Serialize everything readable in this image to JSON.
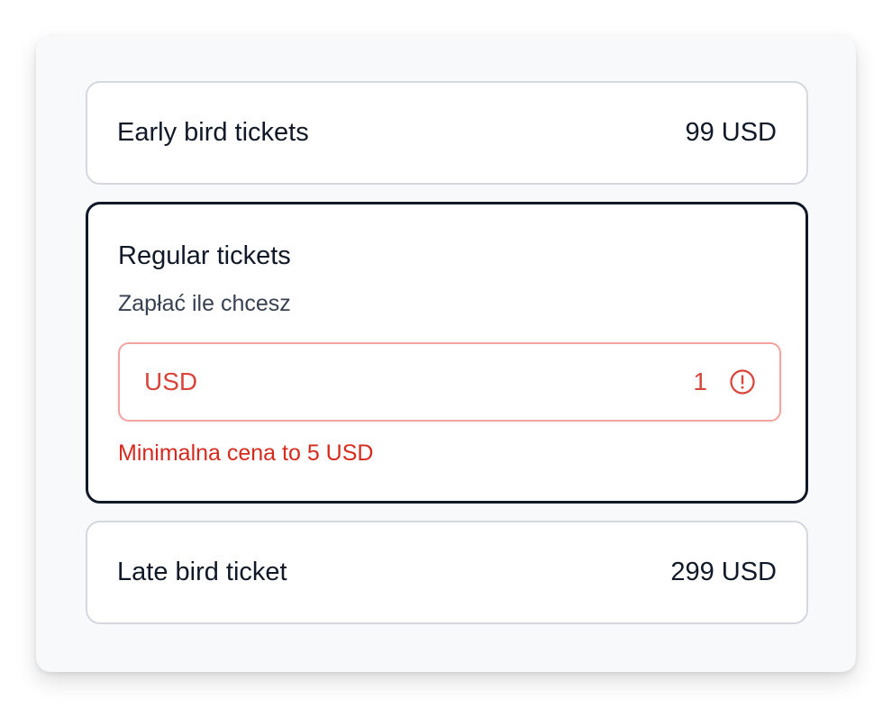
{
  "tickets": [
    {
      "name": "Early bird tickets",
      "price": "99 USD"
    },
    {
      "name": "Regular tickets",
      "subtitle": "Zapłać ile chcesz",
      "currency": "USD",
      "amount": "1",
      "error": "Minimalna cena to 5 USD"
    },
    {
      "name": "Late bird ticket",
      "price": "299 USD"
    }
  ],
  "colors": {
    "error": "#d62a1e",
    "error_border": "#f3a3a0",
    "selected_border": "#111827",
    "card_border": "#d4d8de"
  },
  "icons": {
    "input_status": "exclamation-circle-icon"
  }
}
